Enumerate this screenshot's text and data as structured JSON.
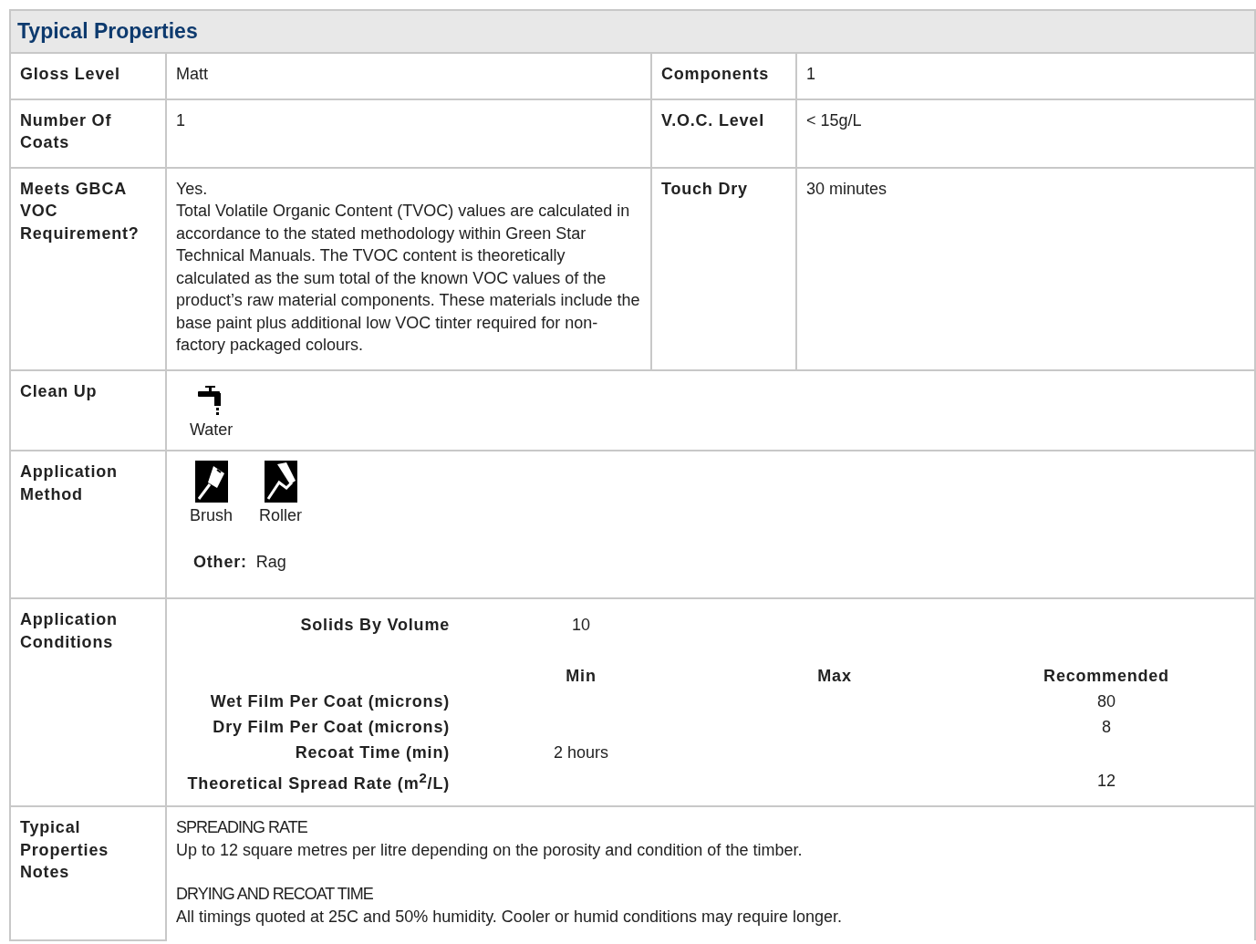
{
  "title": "Typical Properties",
  "pair_rows": [
    {
      "left": {
        "label": "Gloss Level",
        "value": "Matt"
      },
      "right": {
        "label": "Components",
        "value": "1"
      }
    },
    {
      "left": {
        "label": "Number Of Coats",
        "value": "1"
      },
      "right": {
        "label": "V.O.C. Level",
        "value": "< 15g/L"
      }
    },
    {
      "left": {
        "label": "Meets GBCA VOC Requirement?",
        "value": "Yes.",
        "detail": "Total Volatile Organic Content (TVOC) values are calculated in accordance to the stated methodology within Green Star Technical Manuals. The TVOC content is theoretically calculated as the sum total of the known VOC values of the product’s raw material components. These materials include the base paint plus additional low VOC tinter required for non-factory packaged colours."
      },
      "right": {
        "label": "Touch Dry",
        "value": "30 minutes"
      }
    }
  ],
  "clean_up": {
    "label": "Clean Up",
    "methods": [
      {
        "kind": "water",
        "label": "Water"
      }
    ]
  },
  "application_method": {
    "label": "Application Method",
    "methods": [
      {
        "kind": "brush",
        "label": "Brush"
      },
      {
        "kind": "roller",
        "label": "Roller"
      }
    ],
    "other_label": "Other:",
    "other_value": "Rag"
  },
  "application_conditions": {
    "label": "Application Conditions",
    "solids": {
      "label": "Solids By Volume",
      "value": "10"
    },
    "columns": [
      "Min",
      "Max",
      "Recommended"
    ],
    "rows": [
      {
        "label": "Wet Film Per Coat (microns)",
        "recommended": "80"
      },
      {
        "label": "Dry Film Per Coat (microns)",
        "recommended": "8"
      },
      {
        "label": "Recoat Time (min)",
        "min": "2 hours"
      },
      {
        "label": "Theoretical Spread Rate (m$^{2}$/L)",
        "recommended": "12"
      }
    ]
  },
  "notes": {
    "label": "Typical Properties Notes",
    "sections": [
      {
        "heading": "SPREADING RATE",
        "text": "Up to 12 square metres per litre depending on the porosity and condition of the timber."
      },
      {
        "heading": "DRYING AND RECOAT TIME",
        "text": "All timings quoted at 25C and 50% humidity. Cooler or humid conditions may require longer."
      }
    ]
  }
}
